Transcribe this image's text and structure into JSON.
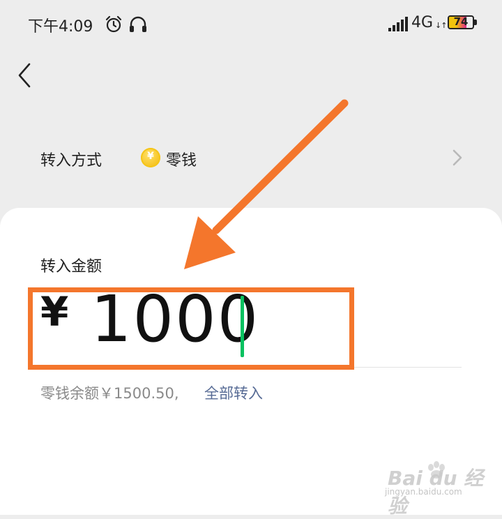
{
  "status_bar": {
    "time": "下午4:09",
    "network": "4G",
    "network_arrows": "↓↑",
    "battery": "74",
    "battery_level": 0.74
  },
  "nav": {
    "back_icon": "chevron-left-icon"
  },
  "transfer_method": {
    "label": "转入方式",
    "coin_symbol": "¥",
    "value": "零钱",
    "chevron_icon": "chevron-right-icon"
  },
  "amount": {
    "label": "转入金额",
    "currency": "¥",
    "value": "1000"
  },
  "balance": {
    "text": "零钱余额￥1500.50,",
    "action": "全部转入"
  },
  "watermark": {
    "brand": "Bai du 经验",
    "site": "jingyan.baidu.com"
  },
  "colors": {
    "accent_green": "#07c160",
    "link_blue": "#576b95",
    "annotation_orange": "#f4762c"
  }
}
